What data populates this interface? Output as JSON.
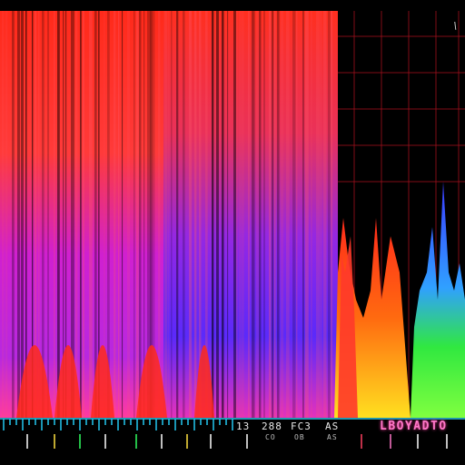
{
  "visualizer": {
    "colors": {
      "red": "#ff2a1a",
      "orange": "#ff7a10",
      "magenta": "#e020d8",
      "violet": "#8a28e8",
      "blue": "#3a3aff",
      "yellow": "#ffe020",
      "green": "#30e840",
      "grid": "#a0101c",
      "ticks": "#22c8f0"
    }
  },
  "readouts": {
    "corner_mark": "\\",
    "value_1": "13",
    "value_2": "288",
    "value_3": "FC3",
    "value_4": "AS",
    "sub_1": "CO",
    "sub_2": "OB",
    "sub_3": "AS"
  },
  "status": {
    "label": "LBOYADTO"
  }
}
